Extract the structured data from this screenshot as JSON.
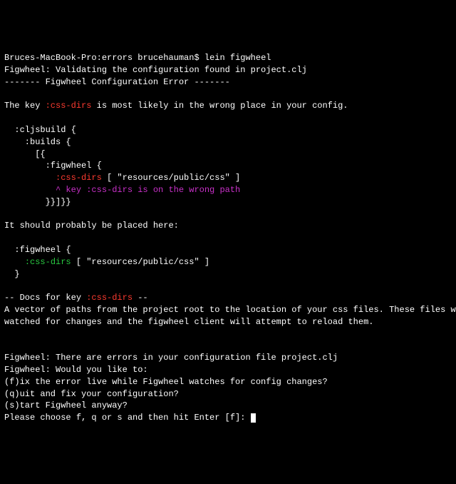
{
  "prompt": {
    "host": "Bruces-MacBook-Pro",
    "dir": "errors",
    "user": "brucehauman",
    "cmd": "lein figwheel"
  },
  "lines": {
    "l1": "Figwheel: Validating the configuration found in project.clj",
    "l2": "------- Figwheel Configuration Error -------",
    "l3": "The key ",
    "l3_key": ":css-dirs",
    "l3_after": " is most likely in the wrong place in your config.",
    "l4": "  :cljsbuild {",
    "l5": "    :builds {",
    "l6": "      [{",
    "l7": "        :figwheel {",
    "l8_indent": "          ",
    "l8_key": ":css-dirs",
    "l8_after": " [ \"resources/public/css\" ]",
    "l9_indent": "          ",
    "l9_msg": "^ key :css-dirs is on the wrong path",
    "l10": "        }}]}}",
    "l11": "It should probably be placed here:",
    "l12": "  :figwheel {",
    "l13_indent": "    ",
    "l13_key": ":css-dirs",
    "l13_after": " [ \"resources/public/css\" ]",
    "l14": "  }",
    "l15_a": "-- Docs for key ",
    "l15_key": ":css-dirs",
    "l15_b": " --",
    "l16": "A vector of paths from the project root to the location of your css files. These files will be",
    "l17": "watched for changes and the figwheel client will attempt to reload them.",
    "l18": "Figwheel: There are errors in your configuration file project.clj",
    "l19": "Figwheel: Would you like to:",
    "l20": "(f)ix the error live while Figwheel watches for config changes?",
    "l21": "(q)uit and fix your configuration?",
    "l22": "(s)tart Figwheel anyway?",
    "l23": "Please choose f, q or s and then hit Enter [f]: "
  }
}
